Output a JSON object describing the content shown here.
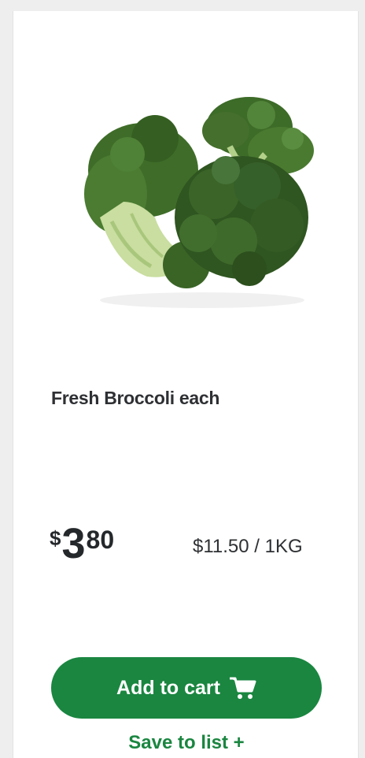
{
  "product": {
    "title": "Fresh Broccoli each",
    "image_icon": "broccoli-image",
    "price": {
      "currency_symbol": "$",
      "dollars": "3",
      "cents": "80"
    },
    "unit_price": "$11.50 / 1KG"
  },
  "actions": {
    "add_to_cart_label": "Add to cart",
    "add_to_cart_icon": "cart-icon",
    "save_to_list_label": "Save to list +"
  },
  "colors": {
    "brand_green": "#1a8640",
    "text_dark": "#2e3033",
    "background": "#eeeeee",
    "card": "#ffffff"
  }
}
